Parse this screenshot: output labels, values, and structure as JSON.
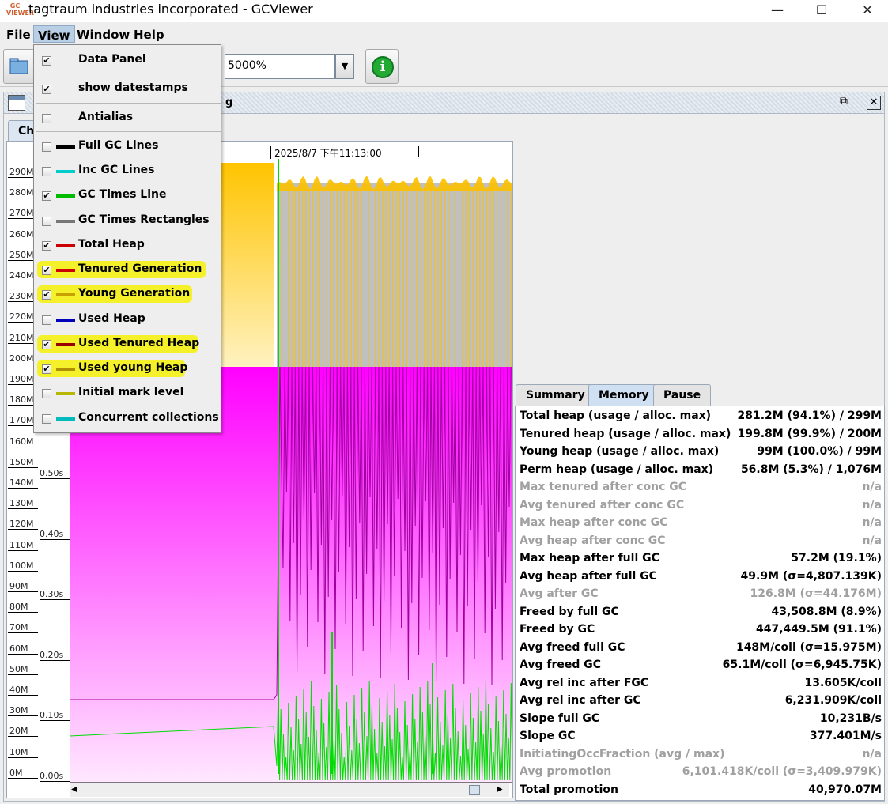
{
  "window": {
    "title": "tagtraum industries incorporated - GCViewer",
    "app_icon": "GC VIEWER",
    "minimize": "—",
    "maximize": "☐",
    "close": "✕"
  },
  "menubar": [
    "File",
    "View",
    "Window",
    "Help"
  ],
  "toolbar": {
    "zoom_value": "5000%",
    "info_label": "i"
  },
  "internal_frame": {
    "file_name": "g"
  },
  "chart_tab": "Ch",
  "chart_data": {
    "type": "line",
    "timestamp_label": "2025/8/7 下午11:13:00",
    "memory_ticks": [
      "290M",
      "280M",
      "270M",
      "260M",
      "250M",
      "240M",
      "230M",
      "220M",
      "210M",
      "200M",
      "190M",
      "180M",
      "170M",
      "160M",
      "150M",
      "140M",
      "130M",
      "120M",
      "110M",
      "100M",
      "90M",
      "80M",
      "70M",
      "60M",
      "50M",
      "40M",
      "30M",
      "20M",
      "10M",
      "0M"
    ],
    "time_ticks": [
      "0.50s",
      "0.40s",
      "0.30s",
      "0.20s",
      "0.10s",
      "0.00s"
    ],
    "ylim_mem": [
      0,
      290
    ],
    "ylim_time": [
      0,
      0.5
    ],
    "series": [
      {
        "name": "Tenured Generation",
        "color": "#fcc000"
      },
      {
        "name": "Young Generation",
        "color": "#c0c0c0"
      },
      {
        "name": "Used Tenured Heap",
        "color": "#ff00ff"
      },
      {
        "name": "GC Times Line",
        "color": "#00dd00"
      }
    ]
  },
  "view_menu": {
    "items": [
      {
        "label": "Data Panel",
        "checked": true,
        "swatch": null,
        "highlight": false
      },
      {
        "label": "show datestamps",
        "checked": true,
        "swatch": null,
        "highlight": false
      },
      {
        "label": "Antialias",
        "checked": false,
        "swatch": null,
        "highlight": false
      },
      {
        "label": "Full GC Lines",
        "checked": false,
        "swatch": "#000000",
        "highlight": false
      },
      {
        "label": "Inc GC Lines",
        "checked": false,
        "swatch": "#00cccc",
        "highlight": false
      },
      {
        "label": "GC Times Line",
        "checked": true,
        "swatch": "#00bb00",
        "highlight": false
      },
      {
        "label": "GC Times Rectangles",
        "checked": false,
        "swatch": "#777777",
        "highlight": false
      },
      {
        "label": "Total Heap",
        "checked": true,
        "swatch": "#cc0000",
        "highlight": false
      },
      {
        "label": "Tenured Generation",
        "checked": true,
        "swatch": "#cc0000",
        "highlight": true
      },
      {
        "label": "Young Generation",
        "checked": true,
        "swatch": "#c8a000",
        "highlight": true
      },
      {
        "label": "Used Heap",
        "checked": false,
        "swatch": "#0000bb",
        "highlight": false
      },
      {
        "label": "Used Tenured Heap",
        "checked": true,
        "swatch": "#990000",
        "highlight": true
      },
      {
        "label": "Used young Heap",
        "checked": true,
        "swatch": "#b09000",
        "highlight": true
      },
      {
        "label": "Initial mark level",
        "checked": false,
        "swatch": "#b8b800",
        "highlight": false
      },
      {
        "label": "Concurrent collections",
        "checked": false,
        "swatch": "#00bbbb",
        "highlight": false
      }
    ]
  },
  "data_panel": {
    "tabs": [
      "Summary",
      "Memory",
      "Pause"
    ],
    "active_tab": "Memory",
    "rows": [
      {
        "label": "Total heap (usage / alloc. max)",
        "value": "281.2M (94.1%) / 299M",
        "dim": false
      },
      {
        "label": "Tenured heap (usage / alloc. max)",
        "value": "199.8M (99.9%) / 200M",
        "dim": false
      },
      {
        "label": "Young heap (usage / alloc. max)",
        "value": "99M (100.0%) / 99M",
        "dim": false
      },
      {
        "label": "Perm heap (usage / alloc. max)",
        "value": "56.8M (5.3%) / 1,076M",
        "dim": false
      },
      {
        "label": "Max tenured after conc GC",
        "value": "n/a",
        "dim": true
      },
      {
        "label": "Avg tenured after conc GC",
        "value": "n/a",
        "dim": true
      },
      {
        "label": "Max heap after conc GC",
        "value": "n/a",
        "dim": true
      },
      {
        "label": "Avg heap after conc GC",
        "value": "n/a",
        "dim": true
      },
      {
        "label": "Max heap after full GC",
        "value": "57.2M (19.1%)",
        "dim": false
      },
      {
        "label": "Avg heap after full GC",
        "value": "49.9M (σ=4,807.139K)",
        "dim": false
      },
      {
        "label": "Avg after GC",
        "value": "126.8M (σ=44.176M)",
        "dim": true
      },
      {
        "label": "Freed by full GC",
        "value": "43,508.8M (8.9%)",
        "dim": false
      },
      {
        "label": "Freed by GC",
        "value": "447,449.5M (91.1%)",
        "dim": false
      },
      {
        "label": "Avg freed full GC",
        "value": "148M/coll (σ=15.975M)",
        "dim": false
      },
      {
        "label": "Avg freed GC",
        "value": "65.1M/coll (σ=6,945.75K)",
        "dim": false
      },
      {
        "label": "Avg rel inc after FGC",
        "value": "13.605K/coll",
        "dim": false
      },
      {
        "label": "Avg rel inc after GC",
        "value": "6,231.909K/coll",
        "dim": false
      },
      {
        "label": "Slope full GC",
        "value": "10,231B/s",
        "dim": false
      },
      {
        "label": "Slope GC",
        "value": "377.401M/s",
        "dim": false
      },
      {
        "label": "InitiatingOccFraction (avg / max)",
        "value": "n/a",
        "dim": true
      },
      {
        "label": "Avg promotion",
        "value": "6,101.418K/coll (σ=3,409.979K)",
        "dim": true
      },
      {
        "label": "Total promotion",
        "value": "40,970.07M",
        "dim": false
      }
    ]
  }
}
